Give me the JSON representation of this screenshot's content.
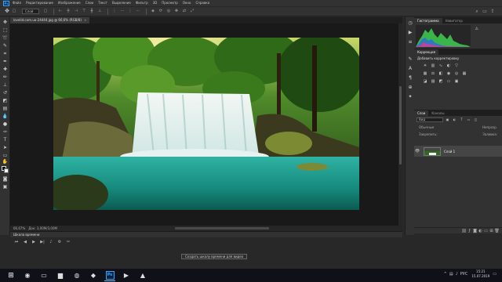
{
  "menu": {
    "logo": "Ps",
    "items": [
      "Файл",
      "Редактирование",
      "Изображение",
      "Слои",
      "Текст",
      "Выделение",
      "Фильтр",
      "3D",
      "Просмотр",
      "Окно",
      "Справка"
    ]
  },
  "options": {
    "tool_icon": "move-tool-icon",
    "auto_select": "Слой"
  },
  "document": {
    "tab_title": "lovelid.com.ua-24444.jpg @ 66,6% (RGB/8)"
  },
  "status": {
    "zoom": "66,67%",
    "doc_info": "Док: 3,00М/3,00М"
  },
  "timeline": {
    "title": "Шкала времени",
    "create_button": "Создать шкалу времени для видео"
  },
  "panels": {
    "histogram_tabs": [
      "Гистограмма",
      "Навигатор"
    ],
    "adjust_tabs": [
      "Коррекция"
    ],
    "adjust_title": "Добавить корректировку",
    "layers_tabs": [
      "Слои",
      "Каналы"
    ],
    "kind_label": "Вид",
    "blend_mode": "Обычные",
    "opacity_label": "Непрозр.",
    "lock_label": "Закрепить:",
    "fill_label": "Заливка:",
    "layer_name": "Слой 1"
  },
  "taskbar": {
    "language": "РУС",
    "time": "15:21",
    "date": "15.07.2019"
  },
  "colors": {
    "accent": "#31a8ff",
    "water": "#1fa090",
    "forest": "#2f6a1e"
  }
}
